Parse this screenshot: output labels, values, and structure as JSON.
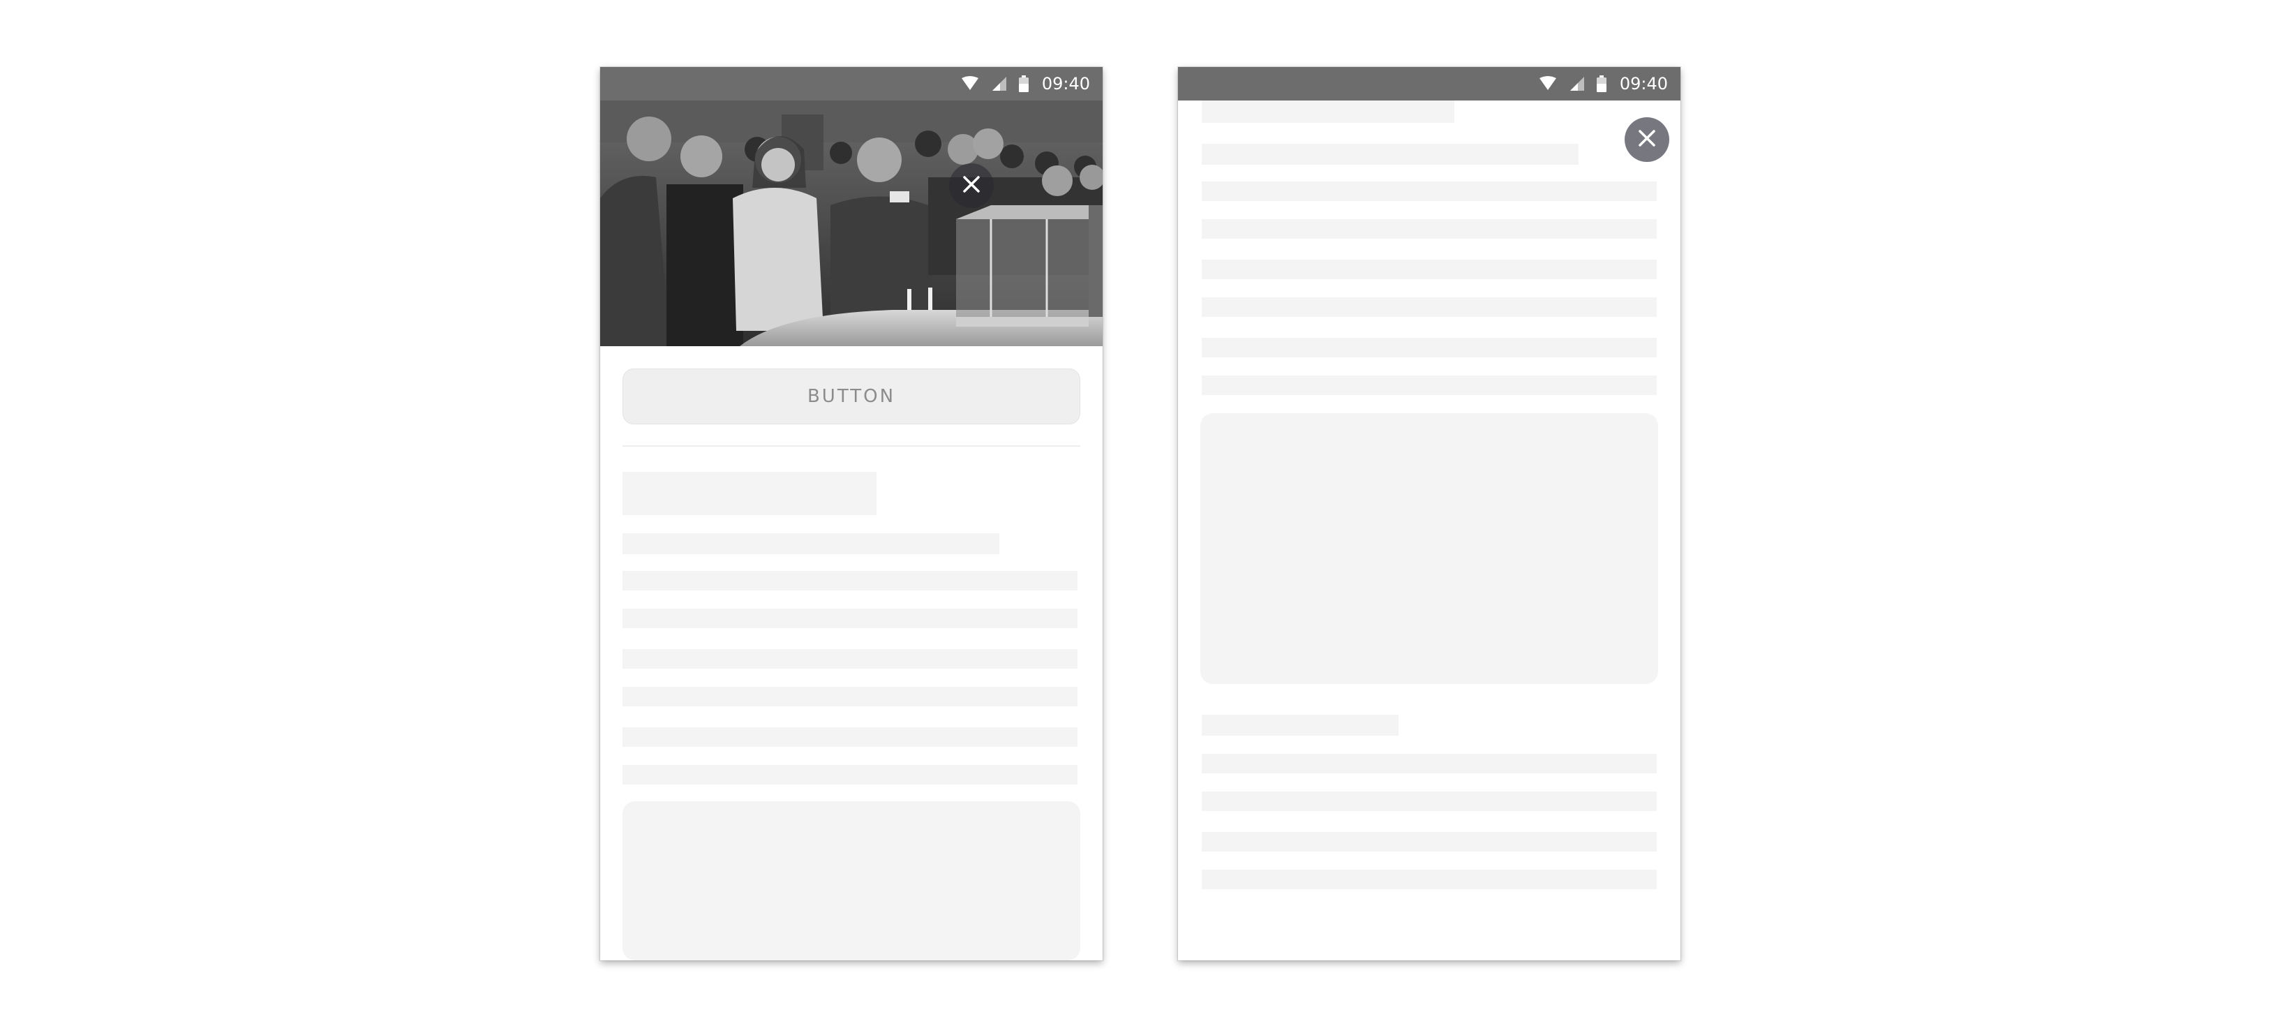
{
  "colors": {
    "status_bar": "#6d6d6d",
    "placeholder": "#f4f4f4",
    "button_bg": "#efefef",
    "button_text": "#8c8c8c",
    "close_overlay": "#77777f"
  },
  "phone_left": {
    "status_bar": {
      "time": "09:40",
      "icons": [
        "wifi-icon",
        "cellular-signal-icon",
        "battery-icon"
      ]
    },
    "close_button": {
      "icon": "close-icon"
    },
    "hero_image": {
      "description_icon": "photo"
    },
    "primary_button": {
      "label": "BUTTON"
    }
  },
  "phone_right": {
    "status_bar": {
      "time": "09:40",
      "icons": [
        "wifi-icon",
        "cellular-signal-icon",
        "battery-icon"
      ]
    },
    "close_button": {
      "icon": "close-icon"
    }
  }
}
